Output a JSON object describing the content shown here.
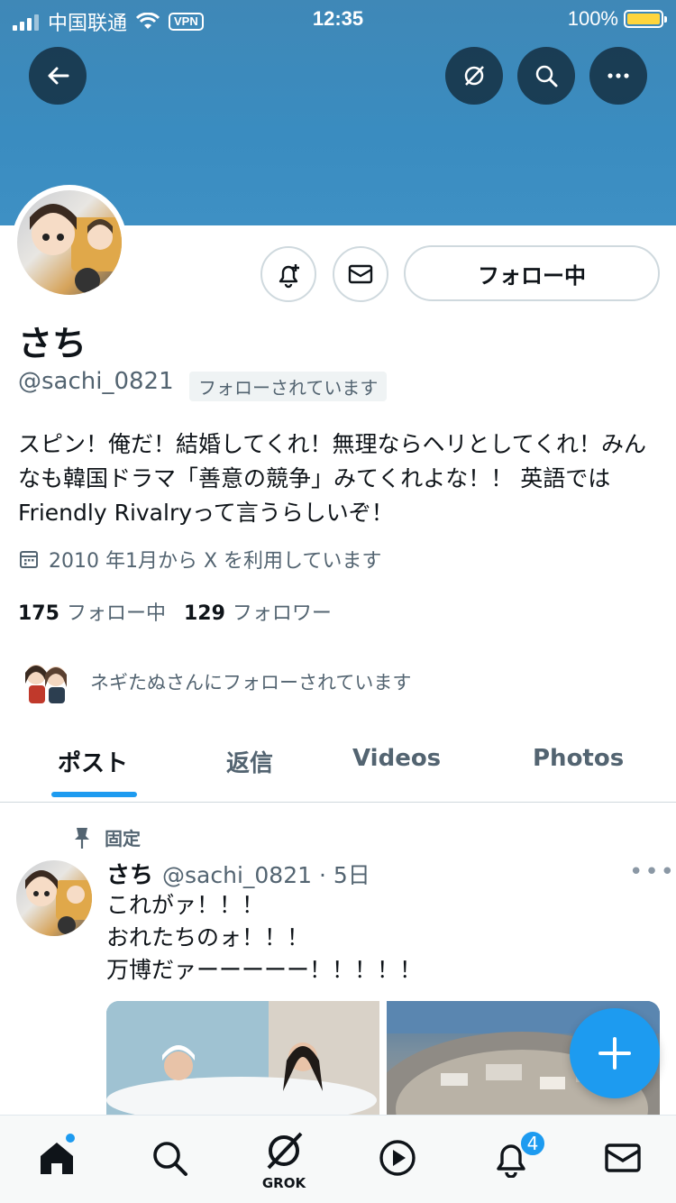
{
  "status_bar": {
    "carrier": "中国联通",
    "vpn": "VPN",
    "time": "12:35",
    "battery": "100%"
  },
  "profile": {
    "display_name": "さち",
    "handle": "@sachi_0821",
    "follows_you": "フォローされています",
    "follow_button": "フォロー中",
    "bio": "スピン！俺だ！結婚してくれ！無理ならヘリとしてくれ！みんなも韓国ドラマ「善意の競争」みてくれよな！！ 英語ではFriendly Rivalryって言うらしいぞ！",
    "joined": "2010 年1月から X を利用しています",
    "following_count": "175",
    "following_label": "フォロー中",
    "followers_count": "129",
    "followers_label": "フォロワー",
    "followed_by": "ネギたぬさんにフォローされています"
  },
  "tabs": [
    {
      "label": "ポスト",
      "active": true
    },
    {
      "label": "返信",
      "active": false
    },
    {
      "label": "Videos",
      "active": false
    },
    {
      "label": "Photos",
      "active": false
    }
  ],
  "pinned_post": {
    "pinned_label": "固定",
    "name": "さち",
    "meta": "@sachi_0821 · 5日",
    "lines": [
      "これがァ！！！",
      "おれたちのォ！！！",
      "万博だァーーーーー！！！！！"
    ]
  },
  "nav": {
    "grok_label": "GROK",
    "notifications_badge": "4"
  },
  "colors": {
    "accent": "#1d9bf0",
    "banner": "#3a8cc0"
  }
}
